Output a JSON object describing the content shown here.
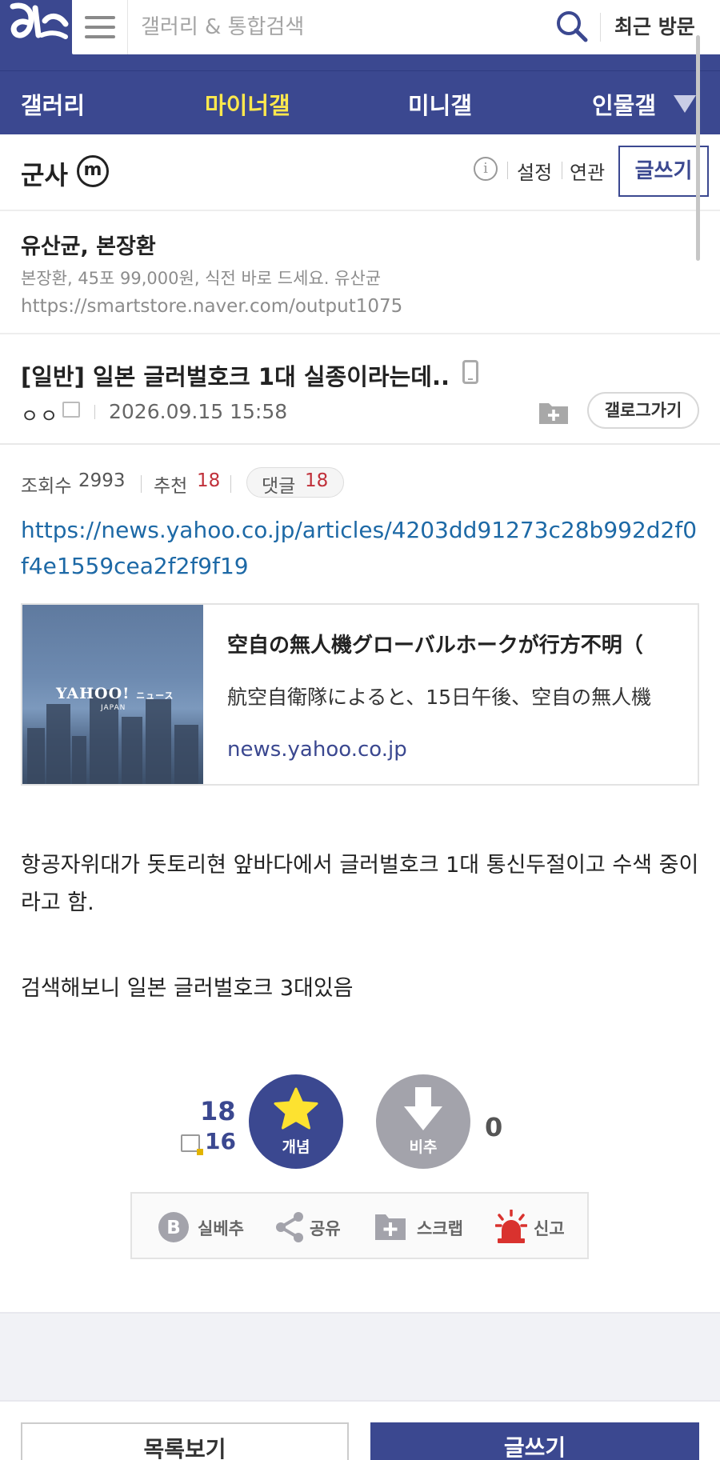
{
  "header": {
    "search_placeholder": "갤러리 & 통합검색",
    "recent_visit": "최근 방문"
  },
  "nav": {
    "items": [
      {
        "label": "갤러리"
      },
      {
        "label": "마이너갤"
      },
      {
        "label": "미니갤"
      },
      {
        "label": "인물갤"
      }
    ],
    "active": "마이너갤"
  },
  "gallery": {
    "title": "군사",
    "badge": "m",
    "settings": "설정",
    "related": "연관",
    "write": "글쓰기"
  },
  "ad": {
    "title": "유산균, 본장환",
    "description": "본장환, 45포 99,000원, 식전 바로 드세요. 유산균",
    "url": "https://smartstore.naver.com/output1075"
  },
  "post": {
    "title": "[일반] 일본 글러벌호크 1대 실종이라는데..",
    "author": "ㅇㅇ",
    "date": "2026.09.15 15:58",
    "gallog_button": "갤로그가기",
    "views_label": "조회수",
    "views": "2993",
    "recommend_label": "추천",
    "recommend": "18",
    "comments_label": "댓글",
    "comments": "18",
    "link": "https://news.yahoo.co.jp/articles/4203dd91273c28b992d2f0f4e1559cea2f2f9f19",
    "card": {
      "logo": "YAHOO!",
      "logo_suffix": "ニュース",
      "logo_sub": "JAPAN",
      "title": "空自の無人機グローバルホークが行方不明（",
      "description": "航空自衛隊によると、15日午後、空自の無人機",
      "domain": "news.yahoo.co.jp"
    },
    "body": [
      "항공자위대가 돗토리현 앞바다에서 글러벌호크 1대 통신두절이고 수색 중이라고 함.",
      "검색해보니 일본 글러벌호크 3대있음"
    ]
  },
  "vote": {
    "up_count": "18",
    "fixed_count": "16",
    "up_label": "개념",
    "down_label": "비추",
    "down_count": "0"
  },
  "actions": {
    "best": "실베추",
    "share": "공유",
    "scrap": "스크랩",
    "report": "신고"
  },
  "bottom": {
    "list": "목록보기",
    "write": "글쓰기"
  },
  "colors": {
    "brand": "#3b4890",
    "active_nav": "#fde84d",
    "link": "#1d69a6",
    "count_red": "#c0303a",
    "report_red": "#d9322e"
  }
}
